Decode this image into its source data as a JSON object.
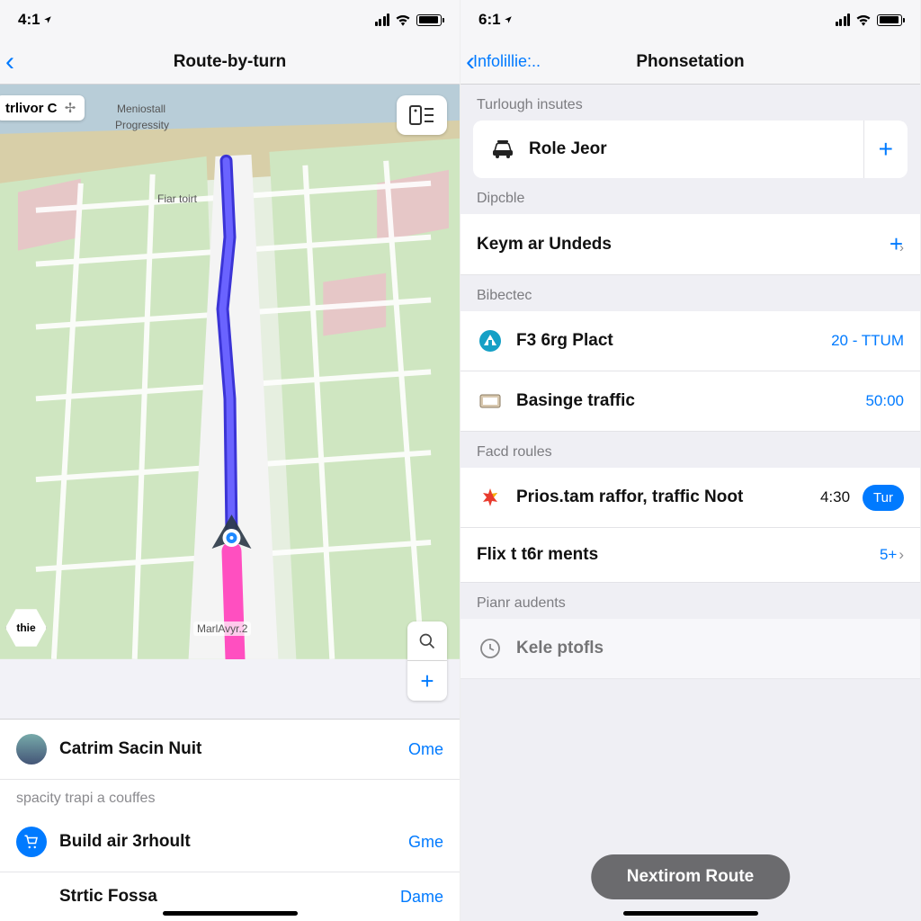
{
  "left": {
    "status_time": "4:1",
    "nav_title": "Route-by-turn",
    "map": {
      "chip_label": "trlivor C",
      "labels": {
        "a": "Meniostall",
        "b": "Progressity",
        "c": "Fiar toirt",
        "d": "MarlAvyr.2"
      },
      "menu_button": "menu",
      "zoom_in": "+",
      "search": "search",
      "hex_label": "thie"
    },
    "panel": {
      "row1": {
        "label": "Catrim Sacin Nuit",
        "action": "Ome"
      },
      "section": "spacity trapi a couffes",
      "row2": {
        "label": "Build air 3rhoult",
        "action": "Gme"
      },
      "row3": {
        "label": "Strtic Fossa",
        "action": "Dame"
      }
    }
  },
  "right": {
    "status_time": "6:1",
    "nav_back": "Infolillie:..",
    "nav_title": "Phonsetation",
    "groups": {
      "g1": {
        "header": "Turlough insutes",
        "row": {
          "label": "Role Jeor"
        }
      },
      "g2": {
        "header": "Dipcble",
        "row": {
          "label": "Keym ar Undeds"
        }
      },
      "g3": {
        "header": "Bibectec",
        "rows": [
          {
            "label": "F3 6rg Plact",
            "meta": "20 - TTUM"
          },
          {
            "label": "Basinge traffic",
            "meta": "50:00"
          }
        ]
      },
      "g4": {
        "header": "Facd roules",
        "rows": [
          {
            "label": "Prios.tam raffor, traffic Noot",
            "meta": "4:30",
            "pill": "Tur"
          },
          {
            "label": "Flix t t6r ments",
            "meta": "5+"
          }
        ]
      },
      "g5": {
        "header": "Pianr audents",
        "row": {
          "label": "Kele ptofls"
        }
      }
    },
    "bottom_button": "Nextirom Route"
  }
}
